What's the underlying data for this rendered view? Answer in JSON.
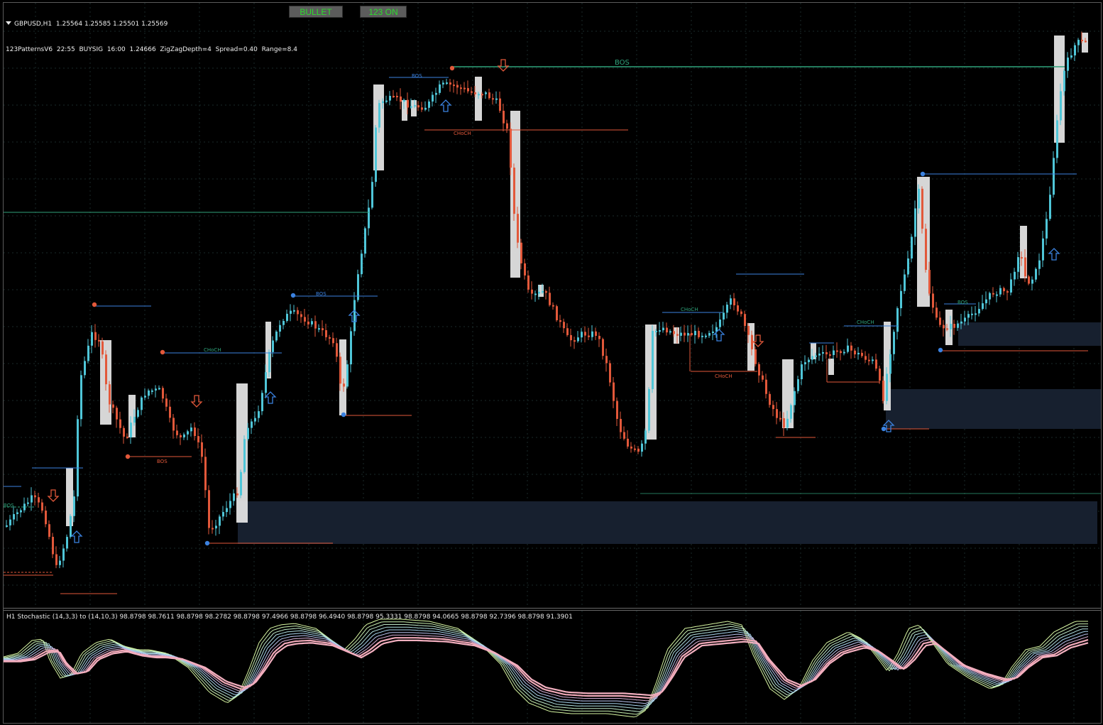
{
  "window": {
    "symbol_line": "GBPUSD,H1  1.25564 1.25585 1.25501 1.25569",
    "indicator_line": "123PatternsV6  22:55  BUYSIG  16:00  1.24666  ZigZagDepth=4  Spread=0.40  Range=8.4"
  },
  "buttons": {
    "bullet": "BULLET",
    "on123": "123 ON"
  },
  "stochastic": {
    "label": "H1 Stochastic (14,3,3) to (14,10,3) 98.8798 98.7611 98.8798 98.2782 98.8798 97.4966 98.8798 96.4940 98.8798 95.3331 98.8798 94.0665 98.8798 92.7396 98.8798 91.3901"
  },
  "annotations": {
    "bos": "BOS",
    "choch": "CHoCH"
  },
  "colors": {
    "background": "#000000",
    "grid": "#1a2a2a",
    "bull_candle": "#4fc6d8",
    "bear_candle": "#e2583a",
    "bos_green": "#2fa27a",
    "swing_blue": "#3b82e0",
    "swing_red": "#e2583a",
    "zone": "#17202f",
    "highlight_box": "#e6e6e6",
    "button_bg": "#5c5c5c",
    "button_text": "#2ddc2d"
  }
}
